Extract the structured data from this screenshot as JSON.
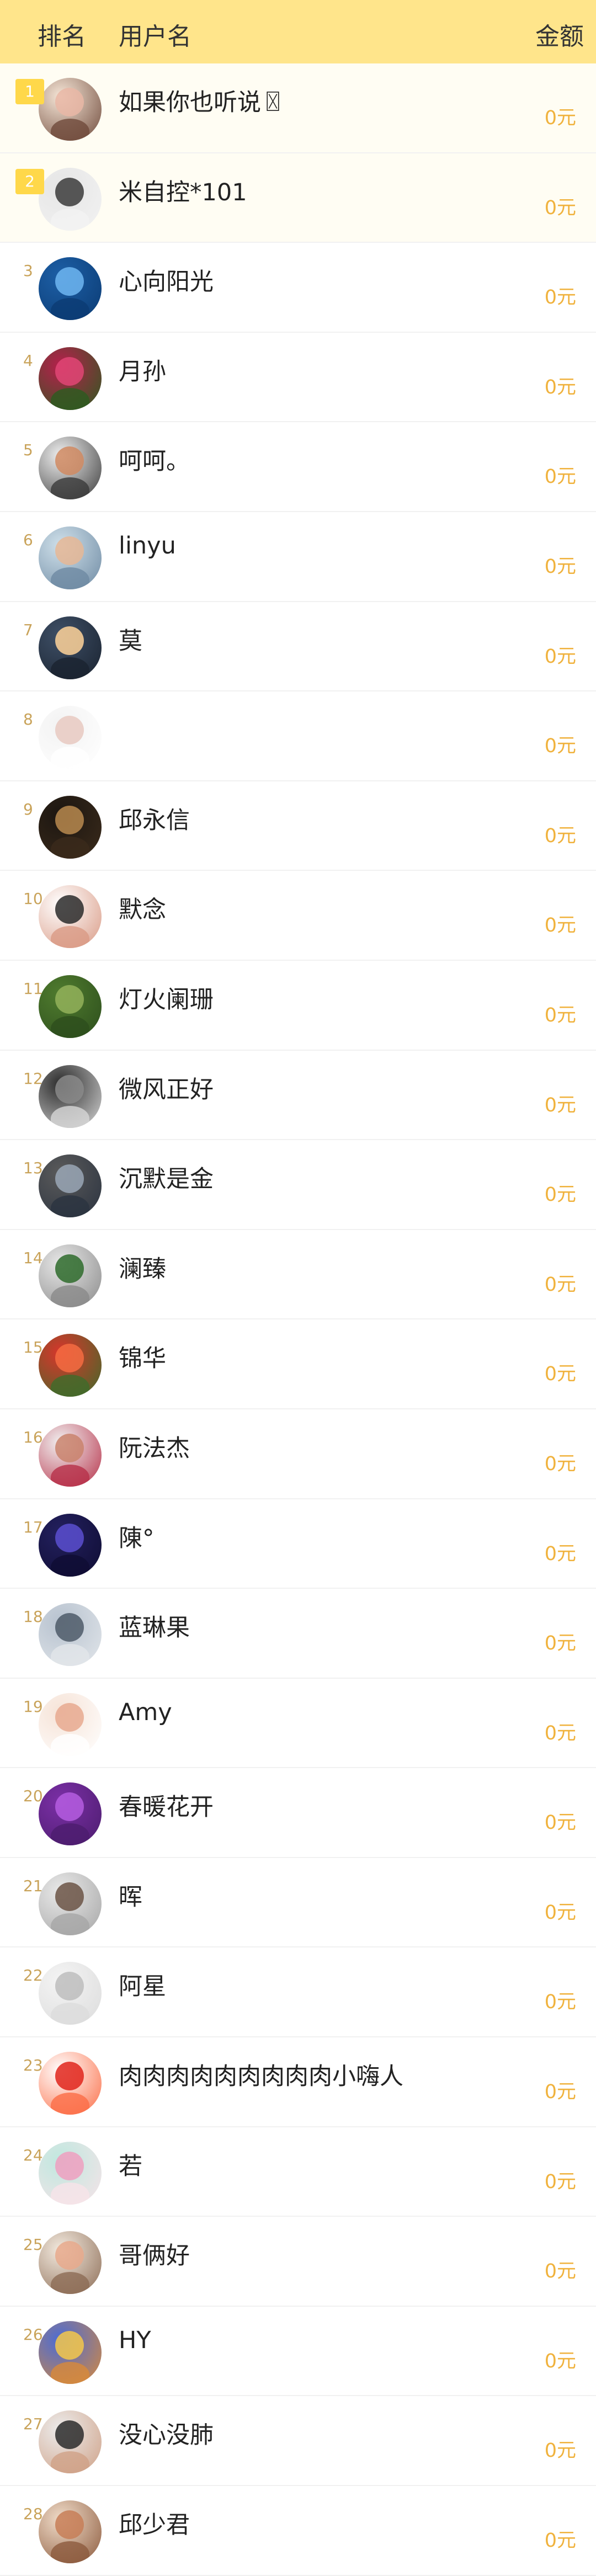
{
  "header": {
    "rank_label": "排名",
    "user_label": "用户名",
    "amount_label": "金额"
  },
  "ranking": [
    {
      "rank": "1",
      "name": "如果你也听说〿",
      "amount": "0元",
      "colors": [
        "#f6e6d7",
        "#e9b7a6",
        "#6f4a3b"
      ]
    },
    {
      "rank": "2",
      "name": "米自控*101",
      "amount": "0元",
      "colors": [
        "#e6e6e6",
        "#3b3b3b",
        "#f2f2f2"
      ]
    },
    {
      "rank": "3",
      "name": "心向阳光",
      "amount": "0元",
      "colors": [
        "#1d5fa6",
        "#6fb6f1",
        "#0b3b73"
      ]
    },
    {
      "rank": "4",
      "name": "月孙",
      "amount": "0元",
      "colors": [
        "#b61f4c",
        "#e04675",
        "#2c5b1f"
      ]
    },
    {
      "rank": "5",
      "name": "呵呵。",
      "amount": "0元",
      "colors": [
        "#efefef",
        "#d08a62",
        "#3a3a3a"
      ]
    },
    {
      "rank": "6",
      "name": "linyu",
      "amount": "0元",
      "colors": [
        "#cfe0ea",
        "#e6b795",
        "#6e8aa3"
      ]
    },
    {
      "rank": "7",
      "name": "莫",
      "amount": "0元",
      "colors": [
        "#3e4f66",
        "#ffd49a",
        "#1a2330"
      ]
    },
    {
      "rank": "8",
      "name": "",
      "amount": "0元",
      "colors": [
        "#f3f3f3",
        "#e8c9c1",
        "#ffffff"
      ]
    },
    {
      "rank": "9",
      "name": "邱永信",
      "amount": "0元",
      "colors": [
        "#1c1611",
        "#b88a4f",
        "#3b2b1b"
      ]
    },
    {
      "rank": "10",
      "name": "默念",
      "amount": "0元",
      "colors": [
        "#ffffff",
        "#2a2a2a",
        "#d99a85"
      ]
    },
    {
      "rank": "11",
      "name": "灯火阑珊",
      "amount": "0元",
      "colors": [
        "#4f7b2e",
        "#93b25a",
        "#2d4e1d"
      ]
    },
    {
      "rank": "12",
      "name": "微风正好",
      "amount": "0元",
      "colors": [
        "#2b2b2b",
        "#8a8a8a",
        "#d7d7d7"
      ]
    },
    {
      "rank": "13",
      "name": "沉默是金",
      "amount": "0元",
      "colors": [
        "#5a5a5a",
        "#9aa7b6",
        "#2b3340"
      ]
    },
    {
      "rank": "14",
      "name": "澜臻",
      "amount": "0元",
      "colors": [
        "#e7e7e7",
        "#2e6b2b",
        "#8a8a8a"
      ]
    },
    {
      "rank": "15",
      "name": "锦华",
      "amount": "0元",
      "colors": [
        "#d9352b",
        "#f46c42",
        "#3e6b2a"
      ]
    },
    {
      "rank": "16",
      "name": "阮法杰",
      "amount": "0元",
      "colors": [
        "#f1f1f1",
        "#c9826c",
        "#b63048"
      ]
    },
    {
      "rank": "17",
      "name": "陳°",
      "amount": "0元",
      "colors": [
        "#23205e",
        "#5a4fd0",
        "#0f0d33"
      ]
    },
    {
      "rank": "18",
      "name": "蓝琳果",
      "amount": "0元",
      "colors": [
        "#b7c2cf",
        "#4e5a68",
        "#e2e6ea"
      ]
    },
    {
      "rank": "19",
      "name": "Amy",
      "amount": "0元",
      "colors": [
        "#f6e3d7",
        "#e8a98f",
        "#ffffff"
      ]
    },
    {
      "rank": "20",
      "name": "春暖花开",
      "amount": "0元",
      "colors": [
        "#7b2fa6",
        "#b55de0",
        "#4c1d6e"
      ]
    },
    {
      "rank": "21",
      "name": "晖",
      "amount": "0元",
      "colors": [
        "#e9e9e9",
        "#6b5445",
        "#a6a6a6"
      ]
    },
    {
      "rank": "22",
      "name": "阿星",
      "amount": "0元",
      "colors": [
        "#f4f4f4",
        "#bdbdbd",
        "#dcdcdc"
      ]
    },
    {
      "rank": "23",
      "name": "肉肉肉肉肉肉肉肉肉小嗨人",
      "amount": "0元",
      "colors": [
        "#ffffff",
        "#e0241b",
        "#fb6d46"
      ]
    },
    {
      "rank": "24",
      "name": "若",
      "amount": "0元",
      "colors": [
        "#bfe8df",
        "#ee9fc0",
        "#f7e3e8"
      ]
    },
    {
      "rank": "25",
      "name": "哥俩好",
      "amount": "0元",
      "colors": [
        "#f3eadf",
        "#e7a98c",
        "#8c6c55"
      ]
    },
    {
      "rank": "26",
      "name": "HY",
      "amount": "0元",
      "colors": [
        "#4a6bd6",
        "#f5c84a",
        "#d88a3a"
      ]
    },
    {
      "rank": "27",
      "name": "没心没肺",
      "amount": "0元",
      "colors": [
        "#ececec",
        "#2b2b2b",
        "#cfa187"
      ]
    },
    {
      "rank": "28",
      "name": "邱少君",
      "amount": "0元",
      "colors": [
        "#f0dcc9",
        "#c77e57",
        "#8c5a3d"
      ]
    }
  ]
}
